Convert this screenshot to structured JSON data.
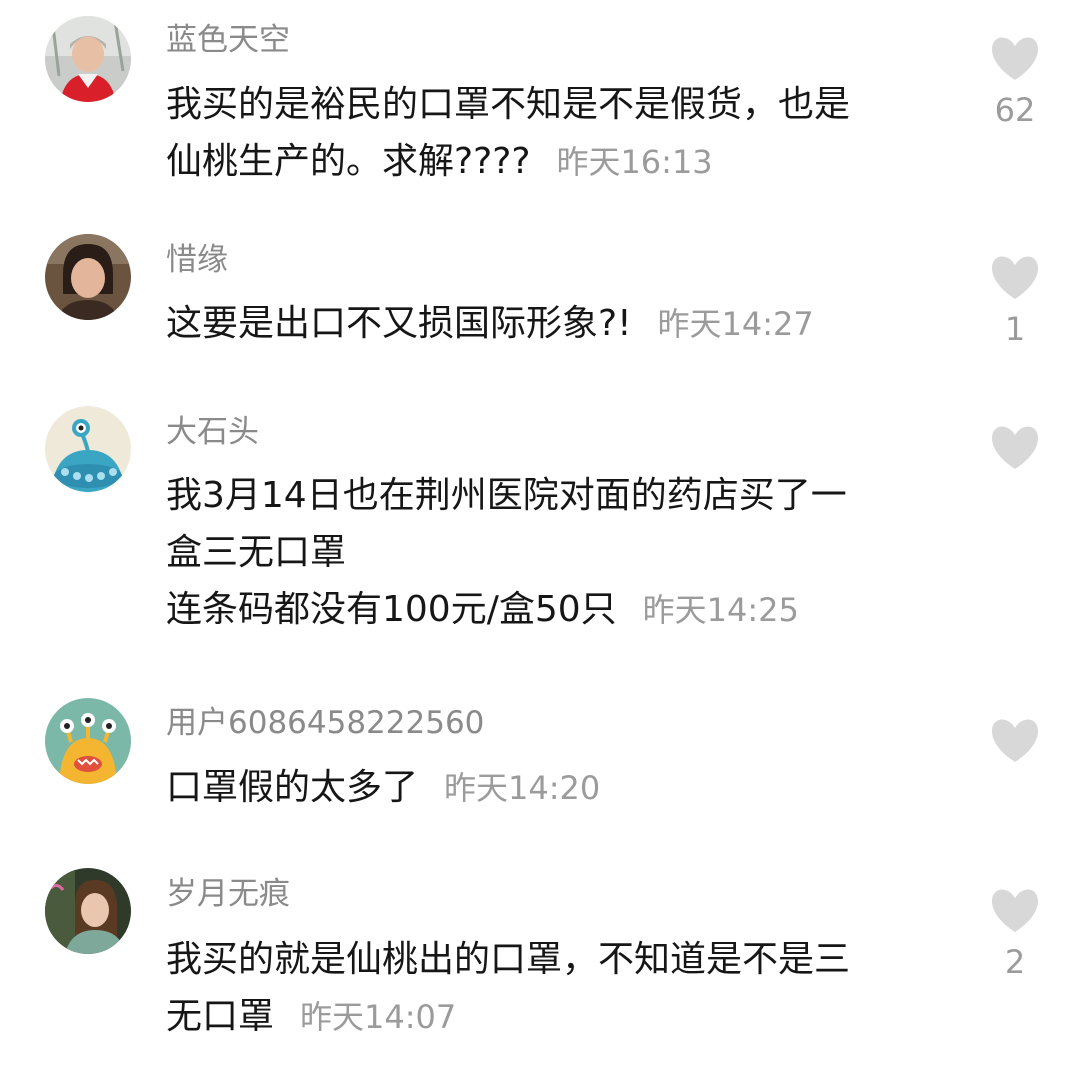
{
  "comments": [
    {
      "username": "蓝色天空",
      "lines": [
        "我买的是裕民的口罩不知是不是假货，也是",
        "仙桃生产的。求解????"
      ],
      "time": "昨天16:13",
      "likes": "62"
    },
    {
      "username": "惜缘",
      "lines": [
        "这要是出口不又损国际形象?!"
      ],
      "time": "昨天14:27",
      "likes": "1"
    },
    {
      "username": "大石头",
      "lines": [
        "我3月14日也在荆州医院对面的药店买了一",
        "盒三无口罩",
        "连条码都没有100元/盒50只"
      ],
      "time": "昨天14:25",
      "likes": ""
    },
    {
      "username": "用户6086458222560",
      "lines": [
        "口罩假的太多了"
      ],
      "time": "昨天14:20",
      "likes": ""
    },
    {
      "username": "岁月无痕",
      "lines": [
        "我买的就是仙桃出的口罩，不知道是不是三",
        "无口罩"
      ],
      "time": "昨天14:07",
      "likes": "2"
    }
  ],
  "colors": {
    "username": "#8a8a8a",
    "text": "#161616",
    "time": "#9b9b9b",
    "heart": "#d8d8d8"
  },
  "icons": {
    "like": "heart-icon"
  }
}
